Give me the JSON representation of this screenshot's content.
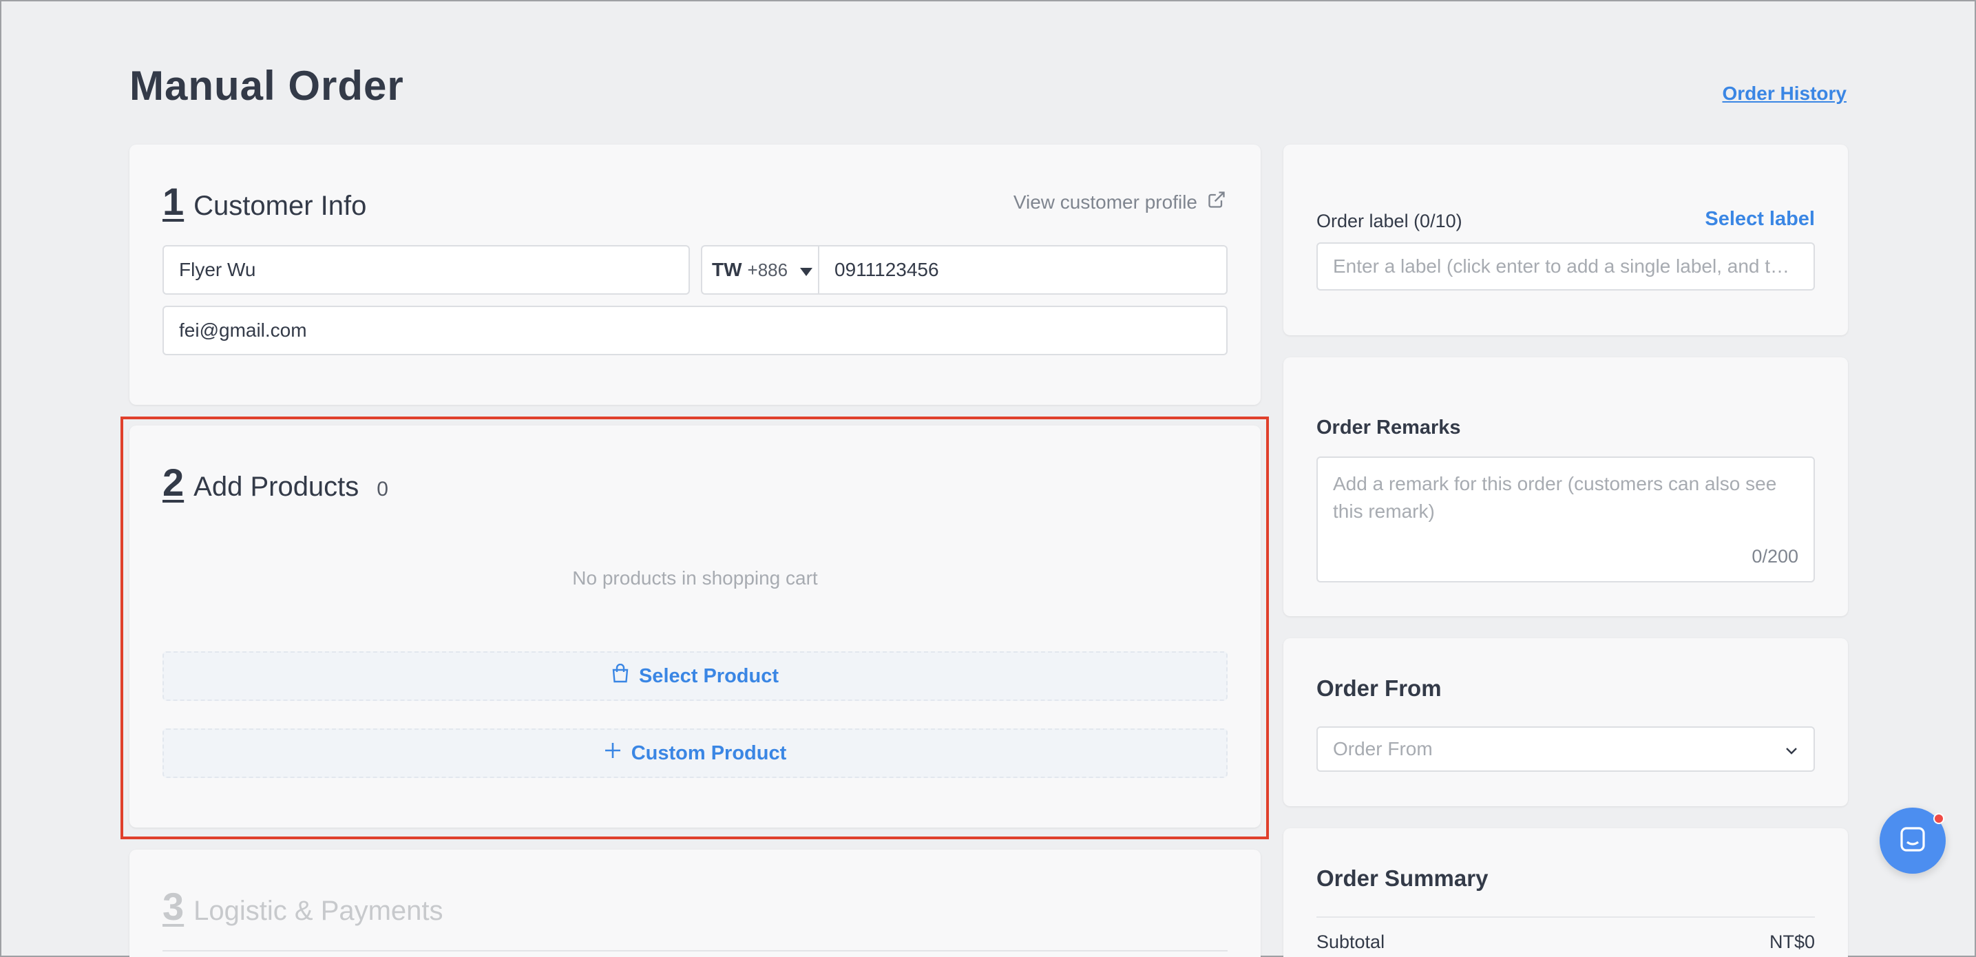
{
  "page": {
    "title": "Manual Order",
    "history_link": "Order History"
  },
  "customer": {
    "num": "1",
    "title": "Customer Info",
    "view_profile": "View customer profile",
    "name": "Flyer Wu",
    "country_code": "TW",
    "dial_code": "+886",
    "phone": "0911123456",
    "email": "fei@gmail.com"
  },
  "products": {
    "num": "2",
    "title": "Add Products",
    "count": "0",
    "empty_text": "No products in shopping cart",
    "select_button": "Select Product",
    "custom_button": "Custom Product"
  },
  "logistics": {
    "num": "3",
    "title": "Logistic & Payments"
  },
  "order_label": {
    "label": "Order label (0/10)",
    "select": "Select label",
    "placeholder": "Enter a label (click enter to add a single label, and t…"
  },
  "remarks": {
    "label": "Order Remarks",
    "placeholder": "Add a remark for this order (customers can also see this remark)",
    "counter": "0/200"
  },
  "order_from": {
    "title": "Order From",
    "placeholder": "Order From"
  },
  "summary": {
    "title": "Order Summary",
    "subtotal_label": "Subtotal",
    "subtotal_value": "NT$0"
  },
  "colors": {
    "accent": "#3a86e4",
    "highlight": "#e0402c",
    "chat": "#4c8ef0"
  },
  "icons": [
    "external-link-icon",
    "caret-down-icon",
    "shopping-bag-icon",
    "plus-icon",
    "chevron-down-icon",
    "chat-icon"
  ]
}
